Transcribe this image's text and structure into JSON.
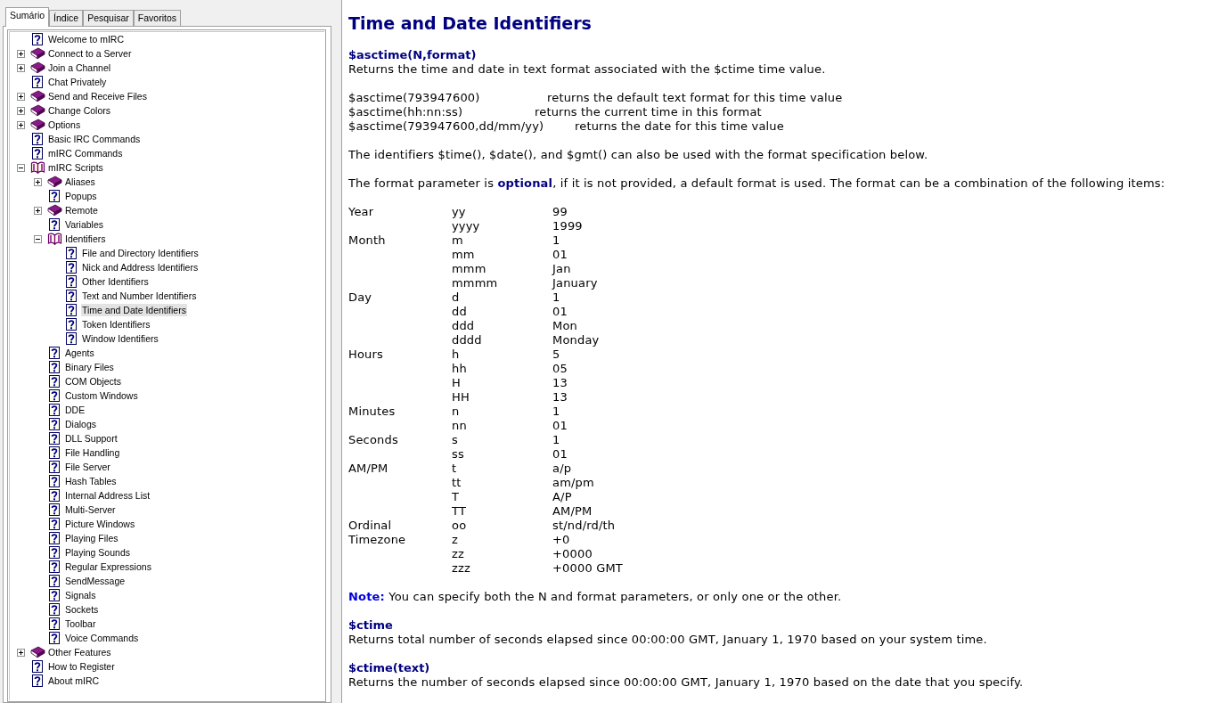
{
  "help_nav": {
    "tabs": [
      {
        "label": "Sumário",
        "selected": true
      },
      {
        "label": "Índice",
        "selected": false
      },
      {
        "label": "Pesquisar",
        "selected": false
      },
      {
        "label": "Favoritos",
        "selected": false
      }
    ],
    "tree": [
      {
        "label": "Welcome to mIRC",
        "kind": "page",
        "selected": false
      },
      {
        "label": "Connect to a Server",
        "kind": "book",
        "expanded": false,
        "selected": false
      },
      {
        "label": "Join a Channel",
        "kind": "book",
        "expanded": false,
        "selected": false
      },
      {
        "label": "Chat Privately",
        "kind": "page",
        "selected": false
      },
      {
        "label": "Send and Receive Files",
        "kind": "book",
        "expanded": false,
        "selected": false
      },
      {
        "label": "Change Colors",
        "kind": "book",
        "expanded": false,
        "selected": false
      },
      {
        "label": "Options",
        "kind": "book",
        "expanded": false,
        "selected": false
      },
      {
        "label": "Basic IRC Commands",
        "kind": "page",
        "selected": false
      },
      {
        "label": "mIRC Commands",
        "kind": "page",
        "selected": false
      },
      {
        "label": "mIRC Scripts",
        "kind": "book",
        "expanded": true,
        "selected": false,
        "children": [
          {
            "label": "Aliases",
            "kind": "book",
            "expanded": false,
            "selected": false
          },
          {
            "label": "Popups",
            "kind": "page",
            "selected": false
          },
          {
            "label": "Remote",
            "kind": "book",
            "expanded": false,
            "selected": false
          },
          {
            "label": "Variables",
            "kind": "page",
            "selected": false
          },
          {
            "label": "Identifiers",
            "kind": "book",
            "expanded": true,
            "selected": false,
            "children": [
              {
                "label": "File and Directory Identifiers",
                "kind": "page",
                "selected": false
              },
              {
                "label": "Nick and Address Identifiers",
                "kind": "page",
                "selected": false
              },
              {
                "label": "Other Identifiers",
                "kind": "page",
                "selected": false
              },
              {
                "label": "Text and Number Identifiers",
                "kind": "page",
                "selected": false
              },
              {
                "label": "Time and Date Identifiers",
                "kind": "page",
                "selected": true
              },
              {
                "label": "Token Identifiers",
                "kind": "page",
                "selected": false
              },
              {
                "label": "Window Identifiers",
                "kind": "page",
                "selected": false
              }
            ]
          },
          {
            "label": "Agents",
            "kind": "page",
            "selected": false
          },
          {
            "label": "Binary Files",
            "kind": "page",
            "selected": false
          },
          {
            "label": "COM Objects",
            "kind": "page",
            "selected": false
          },
          {
            "label": "Custom Windows",
            "kind": "page",
            "selected": false
          },
          {
            "label": "DDE",
            "kind": "page",
            "selected": false
          },
          {
            "label": "Dialogs",
            "kind": "page",
            "selected": false
          },
          {
            "label": "DLL Support",
            "kind": "page",
            "selected": false
          },
          {
            "label": "File Handling",
            "kind": "page",
            "selected": false
          },
          {
            "label": "File Server",
            "kind": "page",
            "selected": false
          },
          {
            "label": "Hash Tables",
            "kind": "page",
            "selected": false
          },
          {
            "label": "Internal Address List",
            "kind": "page",
            "selected": false
          },
          {
            "label": "Multi-Server",
            "kind": "page",
            "selected": false
          },
          {
            "label": "Picture Windows",
            "kind": "page",
            "selected": false
          },
          {
            "label": "Playing Files",
            "kind": "page",
            "selected": false
          },
          {
            "label": "Playing Sounds",
            "kind": "page",
            "selected": false
          },
          {
            "label": "Regular Expressions",
            "kind": "page",
            "selected": false
          },
          {
            "label": "SendMessage",
            "kind": "page",
            "selected": false
          },
          {
            "label": "Signals",
            "kind": "page",
            "selected": false
          },
          {
            "label": "Sockets",
            "kind": "page",
            "selected": false
          },
          {
            "label": "Toolbar",
            "kind": "page",
            "selected": false
          },
          {
            "label": "Voice Commands",
            "kind": "page",
            "selected": false
          }
        ]
      },
      {
        "label": "Other Features",
        "kind": "book",
        "expanded": false,
        "selected": false
      },
      {
        "label": "How to Register",
        "kind": "page",
        "selected": false
      },
      {
        "label": "About mIRC",
        "kind": "page",
        "selected": false
      }
    ]
  },
  "article": {
    "title": "Time and Date Identifiers",
    "sections": [
      {
        "heading": "$asctime(N,format)",
        "blocks": [
          {
            "kind": "paragraph",
            "text": "Returns the time and date in text format associated with the $ctime time value."
          },
          {
            "kind": "examples",
            "rows": [
              {
                "code": "$asctime(793947600)",
                "description": "returns the default text format for this time value"
              },
              {
                "code": "$asctime(hh:nn:ss)",
                "description": "returns the current time in this format"
              },
              {
                "code": "$asctime(793947600,dd/mm/yy)",
                "description": "returns the date for this time value"
              }
            ]
          },
          {
            "kind": "paragraph",
            "text": "The identifiers $time(), $date(), and $gmt() can also be used with the format specification below."
          },
          {
            "kind": "paragraph",
            "text": "The format parameter is **optional**, if it is not provided, a default format is used. The format can be a combination of the following items:"
          },
          {
            "kind": "format_table",
            "groups": [
              {
                "label": "Year",
                "items": [
                  {
                    "code": "yy",
                    "example": "99"
                  },
                  {
                    "code": "yyyy",
                    "example": "1999"
                  }
                ]
              },
              {
                "label": "Month",
                "items": [
                  {
                    "code": "m",
                    "example": "1"
                  },
                  {
                    "code": "mm",
                    "example": "01"
                  },
                  {
                    "code": "mmm",
                    "example": "Jan"
                  },
                  {
                    "code": "mmmm",
                    "example": "January"
                  }
                ]
              },
              {
                "label": "Day",
                "items": [
                  {
                    "code": "d",
                    "example": "1"
                  },
                  {
                    "code": "dd",
                    "example": "01"
                  },
                  {
                    "code": "ddd",
                    "example": "Mon"
                  },
                  {
                    "code": "dddd",
                    "example": "Monday"
                  }
                ]
              },
              {
                "label": "Hours",
                "items": [
                  {
                    "code": "h",
                    "example": "5"
                  },
                  {
                    "code": "hh",
                    "example": "05"
                  },
                  {
                    "code": "H",
                    "example": "13"
                  },
                  {
                    "code": "HH",
                    "example": "13"
                  }
                ]
              },
              {
                "label": "Minutes",
                "items": [
                  {
                    "code": "n",
                    "example": "1"
                  },
                  {
                    "code": "nn",
                    "example": "01"
                  }
                ]
              },
              {
                "label": "Seconds",
                "items": [
                  {
                    "code": "s",
                    "example": "1"
                  },
                  {
                    "code": "ss",
                    "example": "01"
                  }
                ]
              },
              {
                "label": "AM/PM",
                "items": [
                  {
                    "code": "t",
                    "example": "a/p"
                  },
                  {
                    "code": "tt",
                    "example": "am/pm"
                  },
                  {
                    "code": "T",
                    "example": "A/P"
                  },
                  {
                    "code": "TT",
                    "example": "AM/PM"
                  }
                ]
              },
              {
                "label": "Ordinal",
                "items": [
                  {
                    "code": "oo",
                    "example": "st/nd/rd/th"
                  }
                ]
              },
              {
                "label": "Timezone",
                "items": [
                  {
                    "code": "z",
                    "example": "+0"
                  },
                  {
                    "code": "zz",
                    "example": "+0000"
                  },
                  {
                    "code": "zzz",
                    "example": "+0000 GMT"
                  }
                ]
              }
            ]
          },
          {
            "kind": "note",
            "text": "**Note:** You can specify both the N and format parameters, or only one or the other."
          }
        ]
      },
      {
        "heading": "$ctime",
        "blocks": [
          {
            "kind": "paragraph",
            "text": "Returns total number of seconds elapsed since 00:00:00 GMT, January 1, 1970 based on your system time."
          }
        ]
      },
      {
        "heading": "$ctime(text)",
        "blocks": [
          {
            "kind": "paragraph",
            "text": "Returns the number of seconds elapsed since 00:00:00 GMT, January 1, 1970 based on the date that you specify."
          }
        ]
      }
    ]
  }
}
